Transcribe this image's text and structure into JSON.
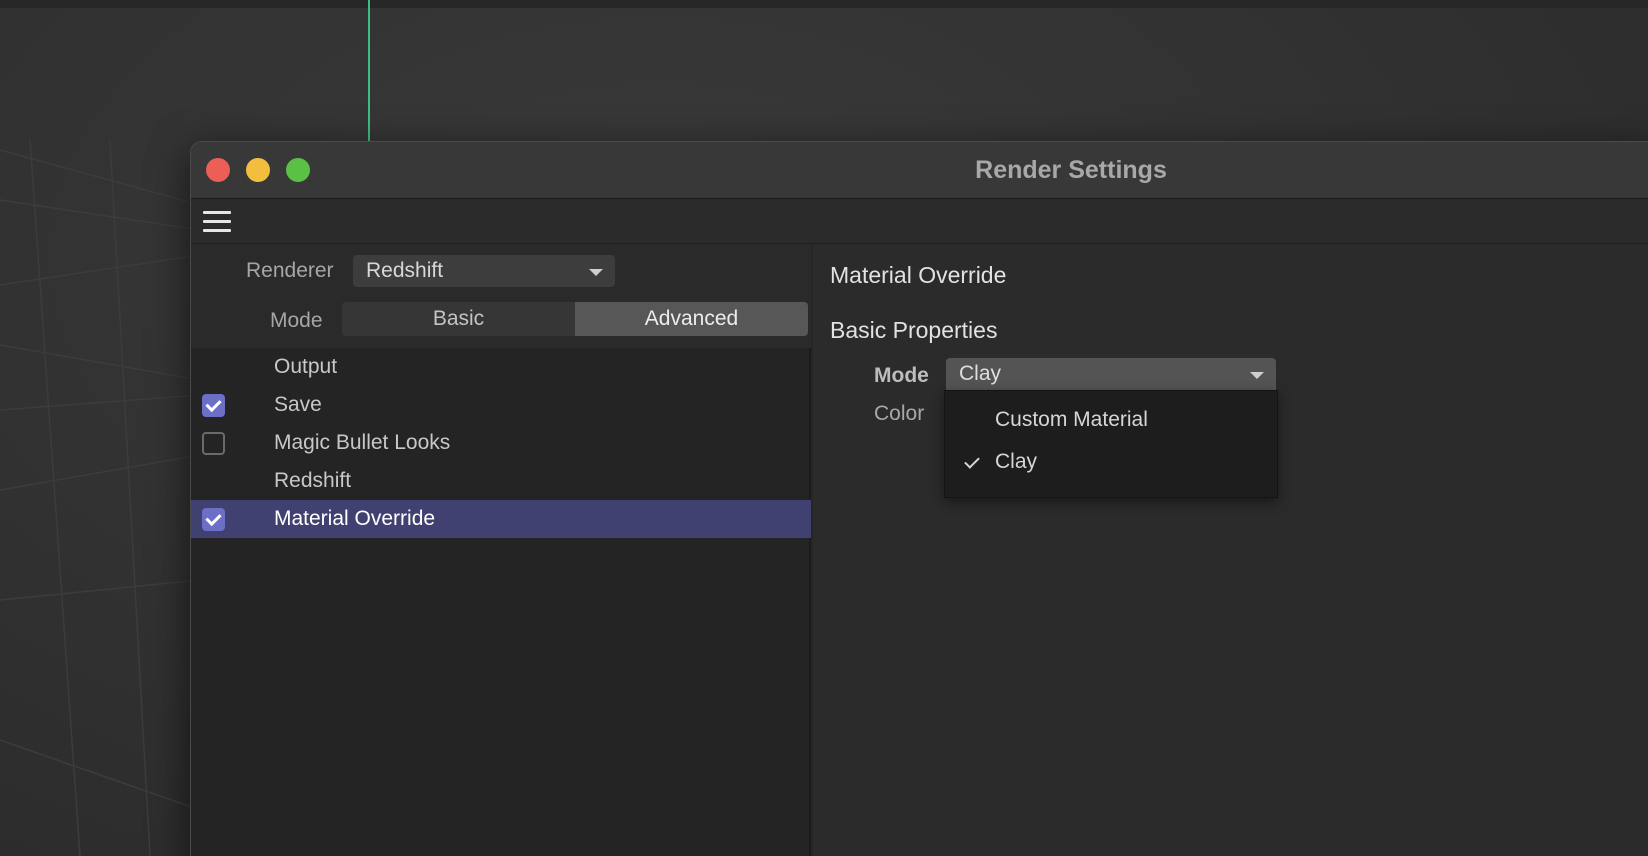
{
  "window": {
    "title": "Render Settings"
  },
  "toolbar": {
    "menu_icon": "hamburger-menu-icon"
  },
  "renderer": {
    "label": "Renderer",
    "value": "Redshift"
  },
  "mode": {
    "label": "Mode",
    "options": [
      "Basic",
      "Advanced"
    ],
    "selected": "Advanced"
  },
  "tree": {
    "items": [
      {
        "label": "Output",
        "checkbox": null,
        "selected": false
      },
      {
        "label": "Save",
        "checkbox": true,
        "selected": false
      },
      {
        "label": "Magic Bullet Looks",
        "checkbox": false,
        "selected": false
      },
      {
        "label": "Redshift",
        "checkbox": null,
        "selected": false
      },
      {
        "label": "Material Override",
        "checkbox": true,
        "selected": true
      }
    ]
  },
  "panel": {
    "title": "Material Override",
    "section": "Basic Properties",
    "mode_label": "Mode",
    "mode_value": "Clay",
    "color_label": "Color",
    "dropdown_options": [
      "Custom Material",
      "Clay"
    ],
    "dropdown_checked": "Clay"
  },
  "colors": {
    "accent": "#6b6fc6",
    "selection": "#404170",
    "close": "#ec5f57",
    "minimize": "#f3bd3e",
    "maximize": "#5ac146",
    "viewport_axis": "#3fbf7f"
  }
}
